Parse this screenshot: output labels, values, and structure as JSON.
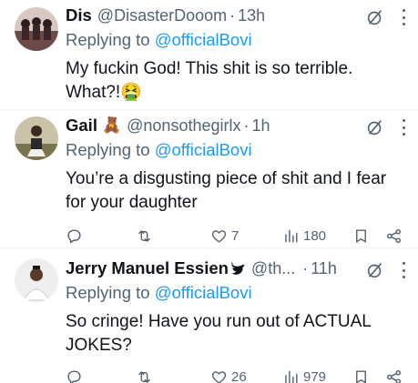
{
  "tweets": [
    {
      "name": "Dis",
      "handle": "@DisasterDooom",
      "time": "13h",
      "replying_prefix": "Replying to ",
      "replying_to": "@officialBovi",
      "text_line1": "My fuckin God! This shit is so terrible.",
      "text_line2": "What?!🤮"
    },
    {
      "name": "Gail",
      "name_emoji": "🧸",
      "handle": "@nonsothegirlx",
      "time": "1h",
      "replying_prefix": "Replying to ",
      "replying_to": "@officialBovi",
      "text_line1": "You’re a disgusting piece of shit and I fear",
      "text_line2": "for your daughter",
      "likes": "7",
      "views": "180"
    },
    {
      "name": "Jerry Manuel Essien",
      "handle": "@th...",
      "time": "11h",
      "replying_prefix": "Replying to ",
      "replying_to": "@officialBovi",
      "text_line1": "So cringe! Have you run out of ACTUAL",
      "text_line2": "JOKES?",
      "likes": "26",
      "views": "979"
    }
  ],
  "icons": [
    "grok-icon",
    "more-icon",
    "reply-icon",
    "retweet-icon",
    "like-icon",
    "views-icon",
    "bookmark-icon",
    "share-icon",
    "verified-icon"
  ],
  "colors": {
    "text": "#0f1419",
    "secondary": "#536471",
    "link": "#1d9bf0",
    "divider": "#eff3f4"
  }
}
